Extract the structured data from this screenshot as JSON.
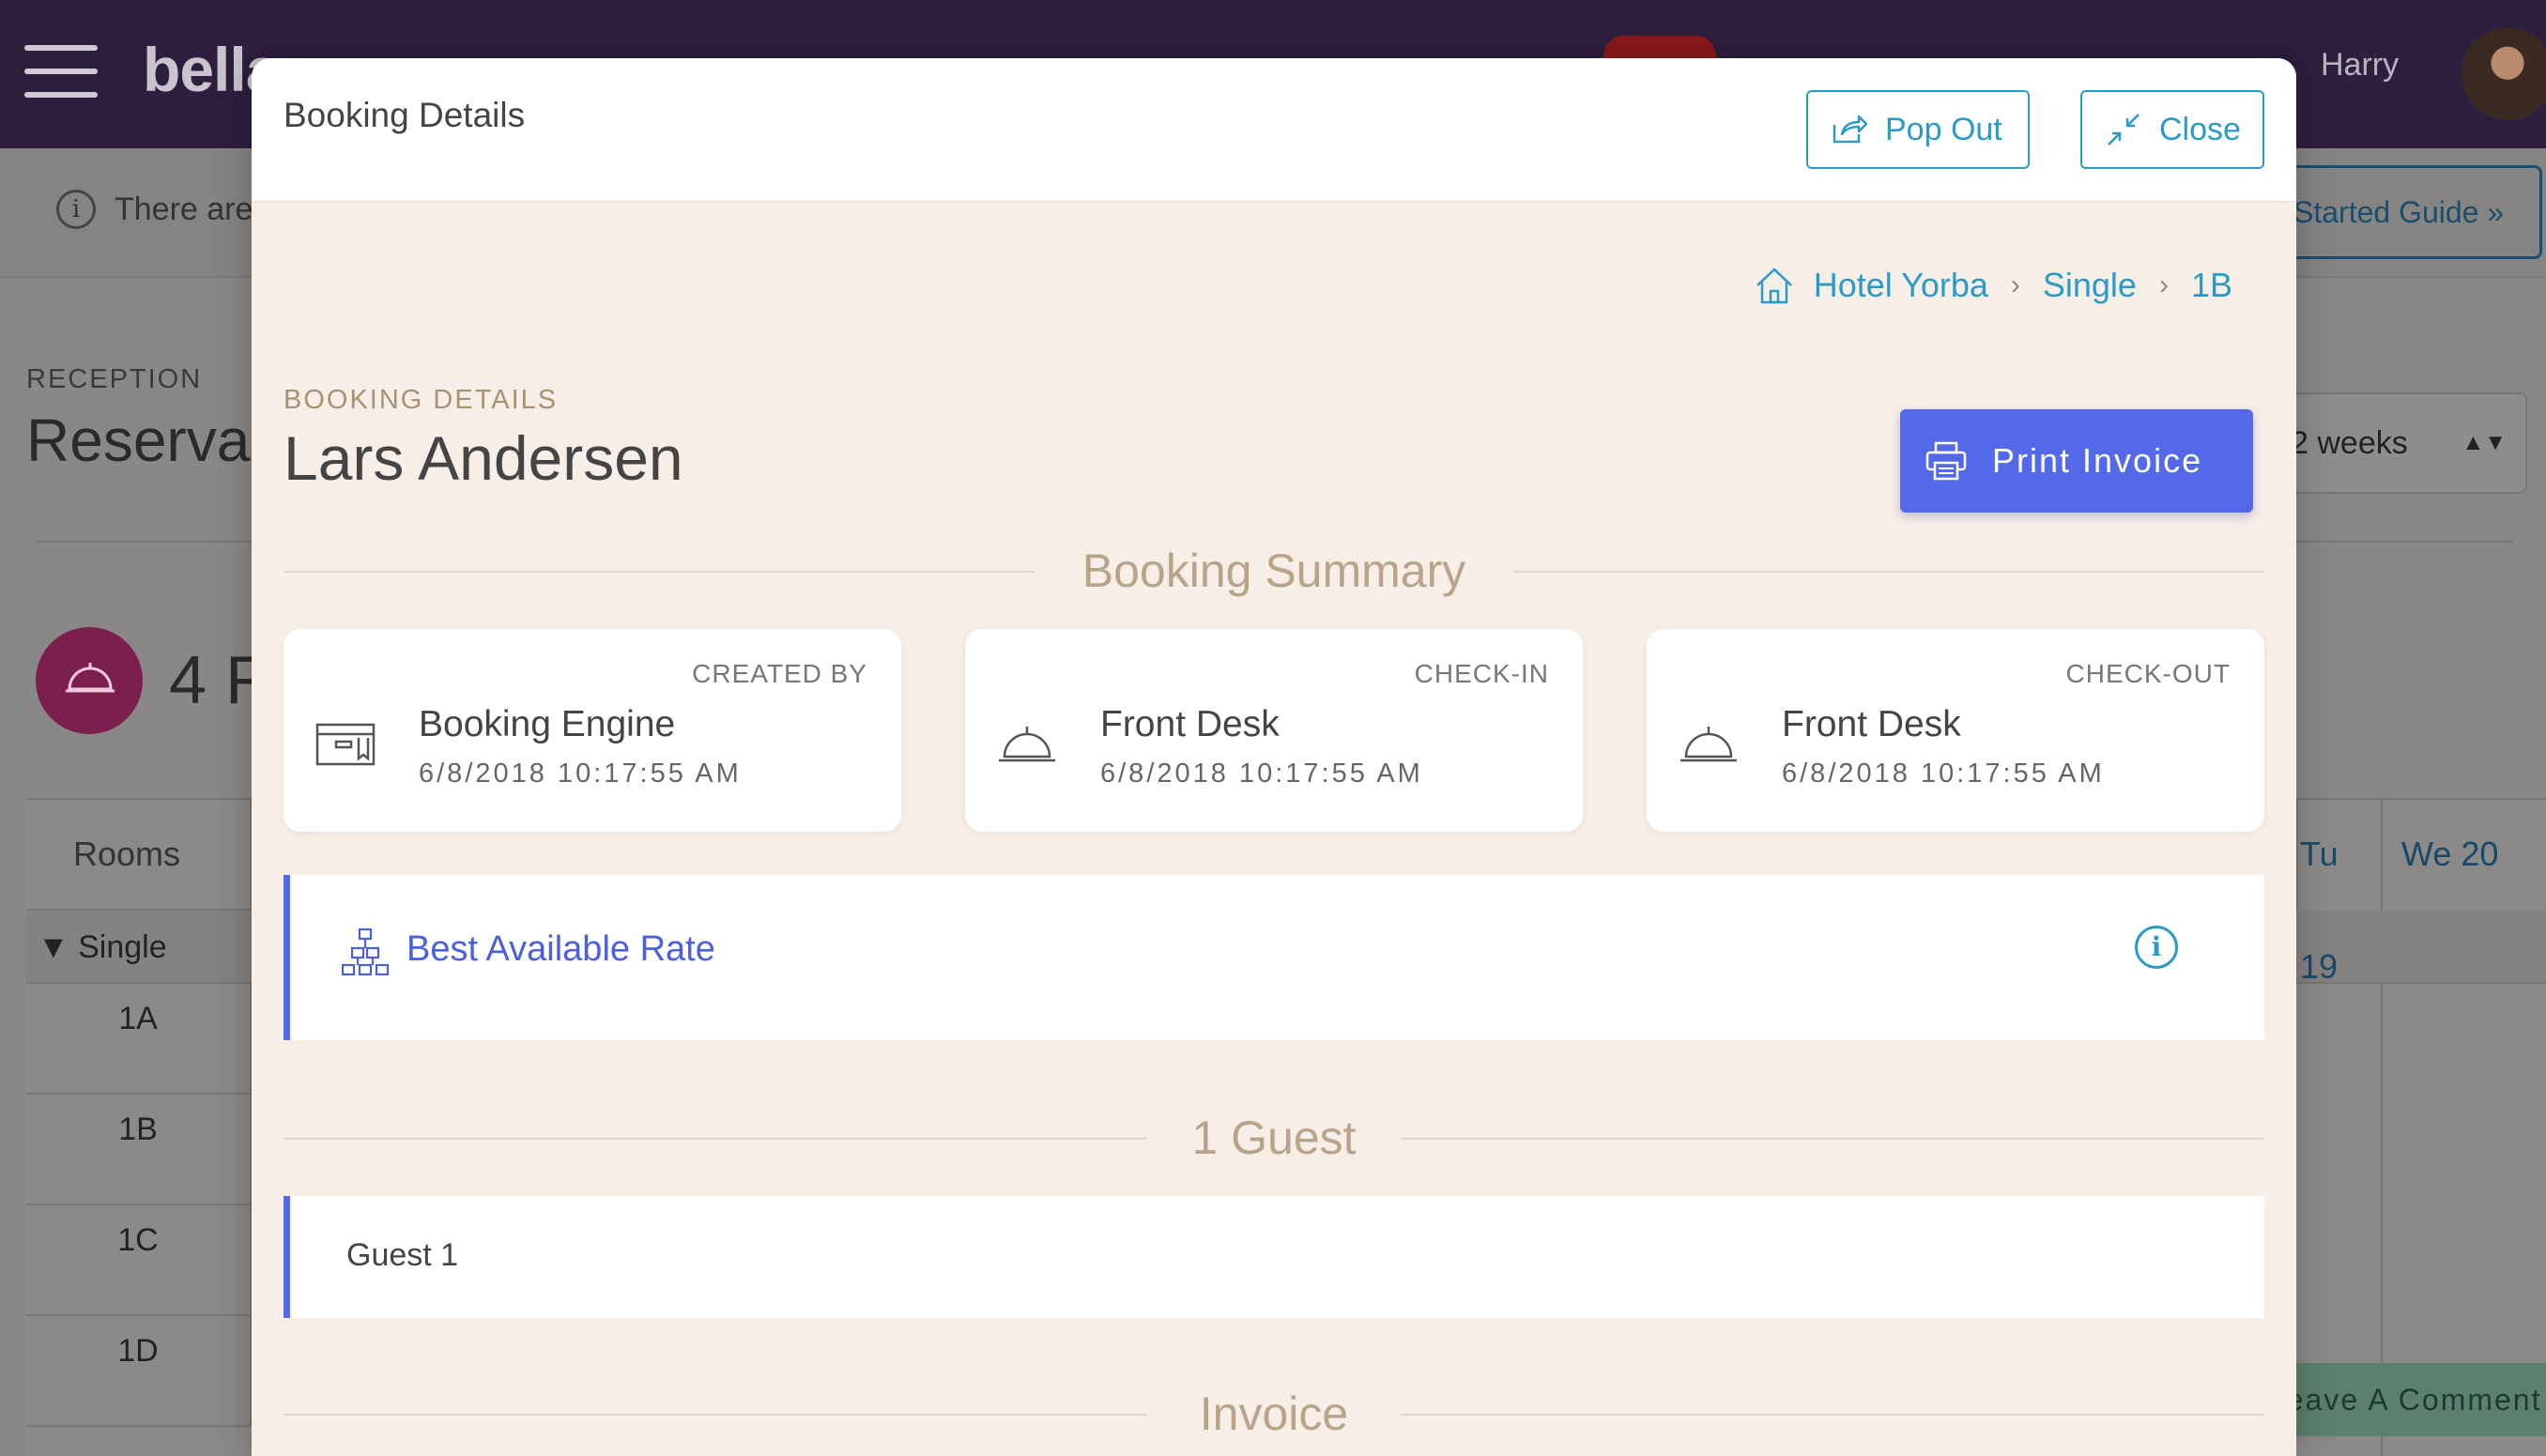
{
  "app": {
    "logo": "bella",
    "user_name": "Harry"
  },
  "infobar": {
    "text": "There are",
    "guide_button": "Started Guide »"
  },
  "page": {
    "section_label": "RECEPTION",
    "title": "Reserva",
    "range_select": "2 weeks",
    "count_text": "4 R"
  },
  "grid": {
    "rooms_header": "Rooms",
    "category": "▼ Single",
    "rooms": [
      "1A",
      "1B",
      "1C",
      "1D"
    ],
    "day_headers": [
      "Tu 19",
      "We 20"
    ],
    "comment_button": "Leave A Comment"
  },
  "modal": {
    "title": "Booking Details",
    "popout_label": "Pop Out",
    "close_label": "Close",
    "breadcrumb": [
      "Hotel Yorba",
      "Single",
      "1B"
    ],
    "booking_label": "BOOKING DETAILS",
    "guest_name": "Lars Andersen",
    "print_label": "Print Invoice",
    "summary_heading": "Booking Summary",
    "cards": [
      {
        "label": "CREATED BY",
        "name": "Booking Engine",
        "date": "6/8/2018 10:17:55 AM",
        "icon": "booking-engine-icon"
      },
      {
        "label": "CHECK-IN",
        "name": "Front Desk",
        "date": "6/8/2018 10:17:55 AM",
        "icon": "reception-bell-icon"
      },
      {
        "label": "CHECK-OUT",
        "name": "Front Desk",
        "date": "6/8/2018 10:17:55 AM",
        "icon": "reception-bell-icon"
      }
    ],
    "rate_name": "Best Available Rate",
    "guests_heading": "1 Guest",
    "guest_1": "Guest 1",
    "invoice_heading": "Invoice"
  },
  "colors": {
    "accent_blue": "#2a9bc7",
    "primary": "#5469e8",
    "modal_bg": "#f6eee7",
    "heading_tan": "#b9a48a"
  }
}
